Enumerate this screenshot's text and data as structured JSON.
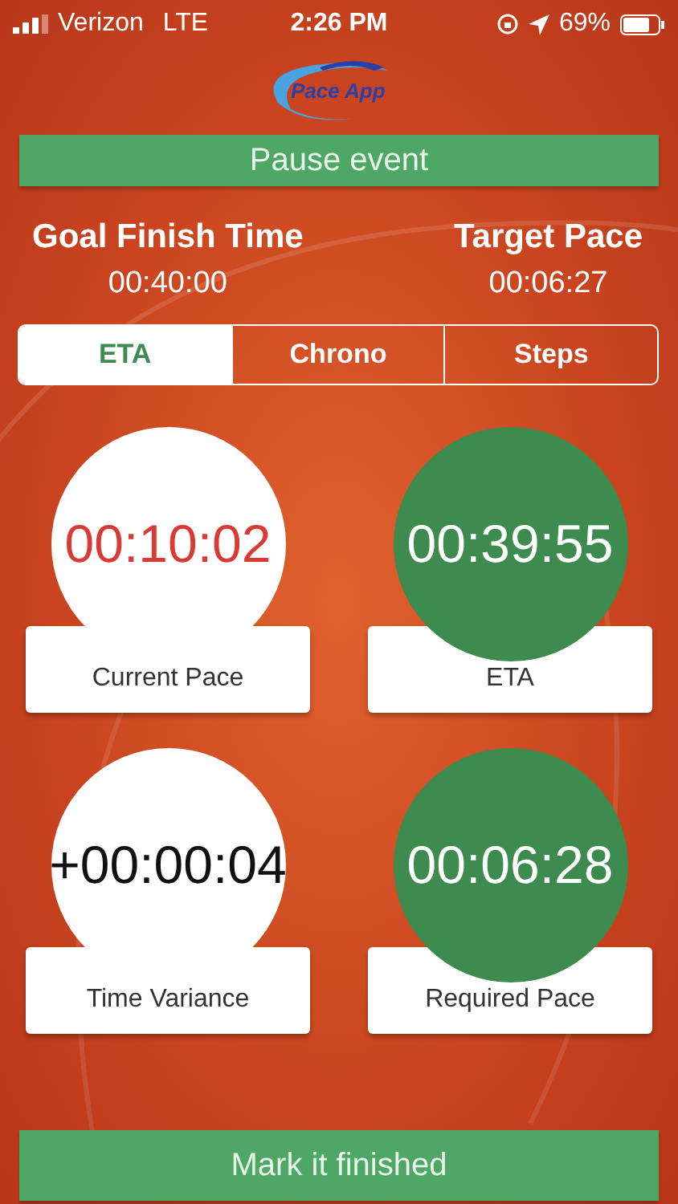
{
  "status_bar": {
    "carrier": "Verizon",
    "network": "LTE",
    "time": "2:26 PM",
    "battery": "69%"
  },
  "logo": {
    "text": "Pace App"
  },
  "pause_button": {
    "label": "Pause event"
  },
  "goals": [
    {
      "label": "Goal Finish Time",
      "value": "00:40:00"
    },
    {
      "label": "Target Pace",
      "value": "00:06:27"
    }
  ],
  "tabs": [
    {
      "label": "ETA",
      "selected": true
    },
    {
      "label": "Chrono",
      "selected": false
    },
    {
      "label": "Steps",
      "selected": false
    }
  ],
  "metrics": [
    {
      "value": "00:10:02",
      "label": "Current Pace",
      "color": "#ffffff",
      "alert": true
    },
    {
      "value": "00:39:55",
      "label": "ETA",
      "color": "#3d8b4f",
      "alert": false
    },
    {
      "value": "+00:00:04",
      "label": "Time Variance",
      "color": "#ffffff",
      "alert": false
    },
    {
      "value": "00:06:28",
      "label": "Required Pace",
      "color": "#3d8b4f",
      "alert": false
    }
  ],
  "finish_button": {
    "label": "Mark it finished"
  }
}
